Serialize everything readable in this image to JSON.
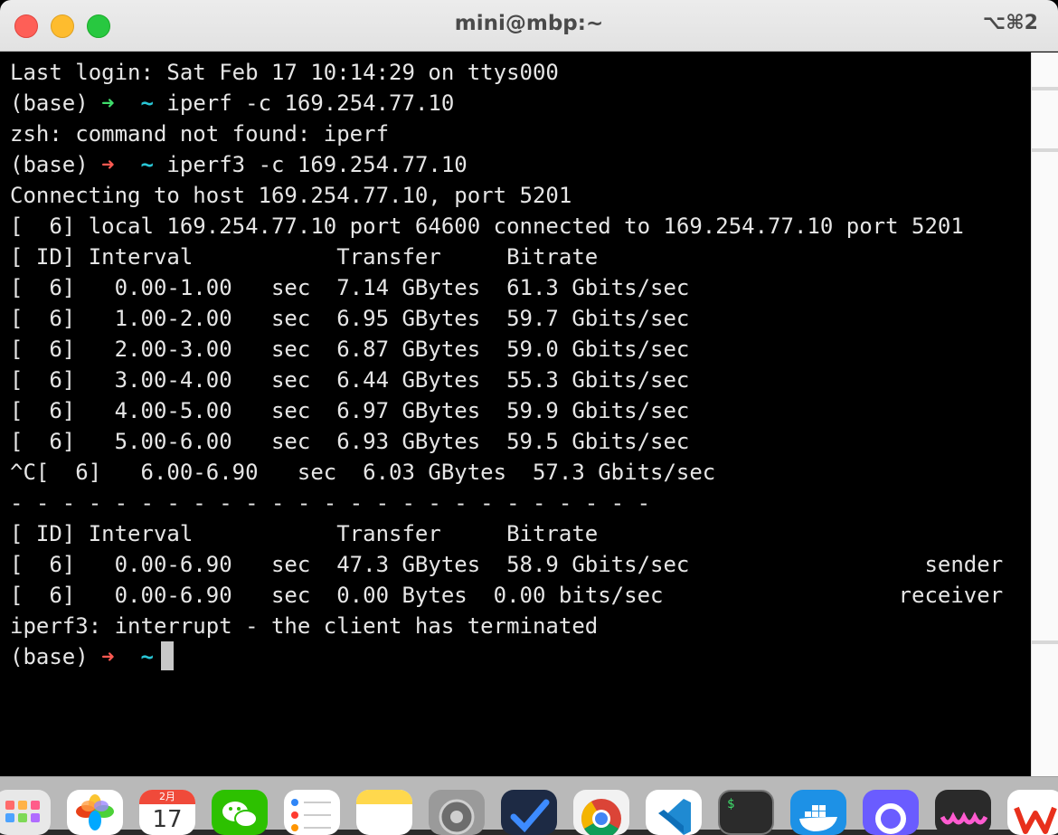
{
  "window": {
    "title": "mini@mbp:~",
    "shortcut": "⌥⌘2"
  },
  "terminal": {
    "lines": [
      {
        "text": "Last login: Sat Feb 17 10:14:29 on ttys000"
      },
      {
        "prefix": "(base) ",
        "arrow": "➜",
        "arrow_color": "green",
        "tilde": "  ~",
        "text": " iperf -c 169.254.77.10"
      },
      {
        "text": "zsh: command not found: iperf"
      },
      {
        "prefix": "(base) ",
        "arrow": "➜",
        "arrow_color": "red",
        "tilde": "  ~",
        "text": " iperf3 -c 169.254.77.10"
      },
      {
        "text": "Connecting to host 169.254.77.10, port 5201"
      },
      {
        "text": "[  6] local 169.254.77.10 port 64600 connected to 169.254.77.10 port 5201"
      },
      {
        "text": "[ ID] Interval           Transfer     Bitrate"
      },
      {
        "text": "[  6]   0.00-1.00   sec  7.14 GBytes  61.3 Gbits/sec"
      },
      {
        "text": "[  6]   1.00-2.00   sec  6.95 GBytes  59.7 Gbits/sec"
      },
      {
        "text": "[  6]   2.00-3.00   sec  6.87 GBytes  59.0 Gbits/sec"
      },
      {
        "text": "[  6]   3.00-4.00   sec  6.44 GBytes  55.3 Gbits/sec"
      },
      {
        "text": "[  6]   4.00-5.00   sec  6.97 GBytes  59.9 Gbits/sec"
      },
      {
        "text": "[  6]   5.00-6.00   sec  6.93 GBytes  59.5 Gbits/sec"
      },
      {
        "text": "^C[  6]   6.00-6.90   sec  6.03 GBytes  57.3 Gbits/sec"
      },
      {
        "text": "- - - - - - - - - - - - - - - - - - - - - - - - -"
      },
      {
        "text": "[ ID] Interval           Transfer     Bitrate"
      },
      {
        "text": "[  6]   0.00-6.90   sec  47.3 GBytes  58.9 Gbits/sec                  sender"
      },
      {
        "text": "[  6]   0.00-6.90   sec  0.00 Bytes  0.00 bits/sec                  receiver"
      },
      {
        "text": "iperf3: interrupt - the client has terminated"
      },
      {
        "prefix": "(base) ",
        "arrow": "➜",
        "arrow_color": "red",
        "tilde": "  ~",
        "text": " "
      }
    ]
  },
  "dock": {
    "items": [
      {
        "name": "launchpad"
      },
      {
        "name": "photos"
      },
      {
        "name": "calendar",
        "month": "2月",
        "day": "17"
      },
      {
        "name": "wechat"
      },
      {
        "name": "reminders"
      },
      {
        "name": "notes"
      },
      {
        "name": "system-settings"
      },
      {
        "name": "instruments"
      },
      {
        "name": "chrome"
      },
      {
        "name": "vscode"
      },
      {
        "name": "terminal",
        "glyph": "$"
      },
      {
        "name": "docker"
      },
      {
        "name": "quark"
      },
      {
        "name": "app-purple"
      },
      {
        "name": "wps"
      }
    ]
  }
}
